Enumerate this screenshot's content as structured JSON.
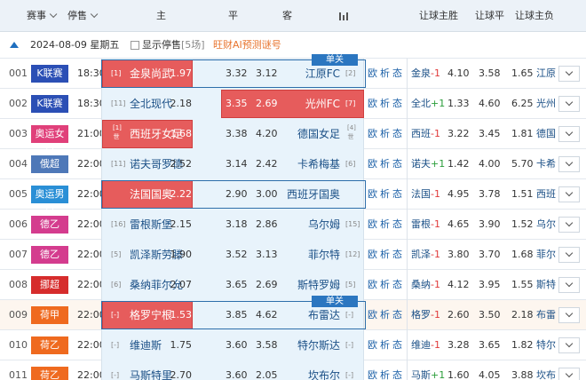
{
  "header": {
    "event": "赛事",
    "stop_sale": "停售",
    "home": "主",
    "draw": "平",
    "away": "客",
    "rq_home_win": "让球主胜",
    "rq_draw": "让球平",
    "rq_home_lose": "让球主负"
  },
  "date_bar": {
    "date": "2024-08-09 星期五",
    "show_stopped": "显示停售",
    "stopped_count": "[5场]",
    "ai_link": "旺财AI预测谜号"
  },
  "tag_label": "单关",
  "links": [
    "欧",
    "析",
    "态"
  ],
  "rows": [
    {
      "idx": "001",
      "league": "K联赛",
      "color": "#2b4fb5",
      "time": "18:30",
      "hr": "[1]",
      "home": "金泉尚武",
      "h": "1.97",
      "d": "3.32",
      "a": "3.12",
      "away": "江原FC",
      "ar": "[2]",
      "rq_team": "金泉",
      "rq": "-1",
      "rq_sign": "n",
      "r1": "4.10",
      "r2": "3.58",
      "r3": "1.65",
      "rq_away": "江原",
      "tag": true,
      "hl": "home"
    },
    {
      "idx": "002",
      "league": "K联赛",
      "color": "#2b4fb5",
      "time": "18:30",
      "hr": "[11]",
      "home": "全北现代",
      "h": "2.18",
      "d": "3.35",
      "a": "2.69",
      "away": "光州FC",
      "ar": "[7]",
      "rq_team": "全北",
      "rq": "+1",
      "rq_sign": "p",
      "r1": "1.33",
      "r2": "4.60",
      "r3": "6.25",
      "rq_away": "光州",
      "tag": false,
      "hl": "drawaway"
    },
    {
      "idx": "003",
      "league": "奥运女足",
      "color": "#e0407a",
      "time": "21:00",
      "hr": "[1]",
      "hr2": "世",
      "home": "西班牙女足",
      "h": "1.68",
      "d": "3.38",
      "a": "4.20",
      "away": "德国女足",
      "ar": "[4]",
      "ar2": "世",
      "rq_team": "西班",
      "rq": "-1",
      "rq_sign": "n",
      "r1": "3.22",
      "r2": "3.45",
      "r3": "1.81",
      "rq_away": "德国",
      "tag": false,
      "hl": "home"
    },
    {
      "idx": "004",
      "league": "俄超",
      "color": "#4e78b8",
      "time": "22:00",
      "hr": "[11]",
      "home": "诺夫哥罗德",
      "h": "2.52",
      "d": "3.14",
      "a": "2.42",
      "away": "卡希梅基",
      "ar": "[6]",
      "rq_team": "诺夫",
      "rq": "+1",
      "rq_sign": "p",
      "r1": "1.42",
      "r2": "4.00",
      "r3": "5.70",
      "rq_away": "卡希",
      "tag": false,
      "hl": "none"
    },
    {
      "idx": "005",
      "league": "奥运男足",
      "color": "#2a8fd6",
      "time": "22:00",
      "hr": "",
      "home": "法国国奥",
      "h": "2.22",
      "d": "2.90",
      "a": "3.00",
      "away": "西班牙国奥",
      "ar": "",
      "rq_team": "法国",
      "rq": "-1",
      "rq_sign": "n",
      "r1": "4.95",
      "r2": "3.78",
      "r3": "1.51",
      "rq_away": "西班",
      "tag": false,
      "hl": "homeframe"
    },
    {
      "idx": "006",
      "league": "德乙",
      "color": "#d43c8e",
      "time": "22:00",
      "hr": "[16]",
      "home": "雷根斯堡",
      "h": "2.15",
      "d": "3.18",
      "a": "2.86",
      "away": "乌尔姆",
      "ar": "[15]",
      "rq_team": "雷根",
      "rq": "-1",
      "rq_sign": "n",
      "r1": "4.65",
      "r2": "3.90",
      "r3": "1.52",
      "rq_away": "乌尔",
      "tag": false,
      "hl": "none"
    },
    {
      "idx": "007",
      "league": "德乙",
      "color": "#d43c8e",
      "time": "22:00",
      "hr": "[5]",
      "home": "凯泽斯劳滕",
      "h": "1.90",
      "d": "3.52",
      "a": "3.13",
      "away": "菲尔特",
      "ar": "[12]",
      "rq_team": "凯泽",
      "rq": "-1",
      "rq_sign": "n",
      "r1": "3.80",
      "r2": "3.70",
      "r3": "1.68",
      "rq_away": "菲尔",
      "tag": false,
      "hl": "none"
    },
    {
      "idx": "008",
      "league": "挪超",
      "color": "#d62c2c",
      "time": "22:00",
      "hr": "[6]",
      "home": "桑纳菲尔允",
      "h": "2.07",
      "d": "3.65",
      "a": "2.69",
      "away": "斯特罗姆",
      "ar": "[5]",
      "rq_team": "桑纳",
      "rq": "-1",
      "rq_sign": "n",
      "r1": "4.12",
      "r2": "3.95",
      "r3": "1.55",
      "rq_away": "斯特",
      "tag": false,
      "hl": "none"
    },
    {
      "idx": "009",
      "league": "荷甲",
      "color": "#ef6a1f",
      "time": "22:00",
      "hr": "[-]",
      "home": "格罗宁根",
      "h": "1.53",
      "d": "3.85",
      "a": "4.62",
      "away": "布雷达",
      "ar": "[-]",
      "rq_team": "格罗",
      "rq": "-1",
      "rq_sign": "n",
      "r1": "2.60",
      "r2": "3.50",
      "r3": "2.18",
      "rq_away": "布雷",
      "tag": true,
      "hl": "home"
    },
    {
      "idx": "010",
      "league": "荷乙",
      "color": "#ef6a1f",
      "time": "22:00",
      "hr": "[-]",
      "home": "维迪斯",
      "h": "1.75",
      "d": "3.60",
      "a": "3.58",
      "away": "特尔斯达",
      "ar": "[-]",
      "rq_team": "维迪",
      "rq": "-1",
      "rq_sign": "n",
      "r1": "3.28",
      "r2": "3.65",
      "r3": "1.82",
      "rq_away": "特尔",
      "tag": false,
      "hl": "none"
    },
    {
      "idx": "011",
      "league": "荷乙",
      "color": "#ef6a1f",
      "time": "22:00",
      "hr": "[-]",
      "home": "马斯特里",
      "h": "2.70",
      "d": "3.60",
      "a": "2.05",
      "away": "坎布尔",
      "ar": "[-]",
      "rq_team": "马斯",
      "rq": "+1",
      "rq_sign": "p",
      "r1": "1.60",
      "r2": "4.05",
      "r3": "3.88",
      "rq_away": "坎布",
      "tag": false,
      "hl": "none"
    }
  ]
}
